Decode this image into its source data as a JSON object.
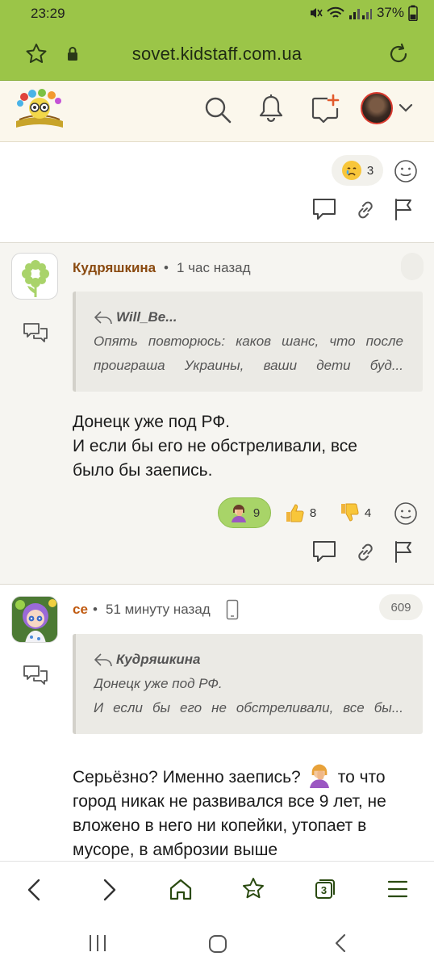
{
  "status_bar": {
    "time": "23:29",
    "battery": "37%"
  },
  "browser": {
    "url": "sovet.kidstaff.com.ua",
    "tabs_count": "3"
  },
  "previous_post": {
    "reaction_count": "3"
  },
  "posts": [
    {
      "author": "Кудряшкина",
      "time": "1 час назад",
      "quote": {
        "author": "Will_Be...",
        "lines": [
          "Опять повторюсь: каков шанс, что после",
          "проиграша Украины, ваши дети буд..."
        ]
      },
      "body": [
        "Донецк уже под РФ.",
        "И если бы его не обстреливали, все",
        "было бы заепись."
      ],
      "reactions": [
        {
          "icon": "facepalm-emoji-icon",
          "count": "9"
        },
        {
          "icon": "thumbs-up-icon",
          "count": "8"
        },
        {
          "icon": "thumbs-down-icon",
          "count": "4"
        }
      ]
    },
    {
      "author": "се",
      "time": "51 минуту назад",
      "post_number": "609",
      "quote": {
        "author": "Кудряшкина",
        "lines": [
          "Донецк уже под РФ.",
          "И если бы его не обстреливали, все бы..."
        ]
      },
      "body_first": "Серьёзно? Именно заепись?",
      "body_first_tail": "то что",
      "body": [
        "город никак не развивался все 9 лет, не",
        "вложено в него ни копейки, утопает в",
        "мусоре, в амброзии выше"
      ]
    }
  ]
}
